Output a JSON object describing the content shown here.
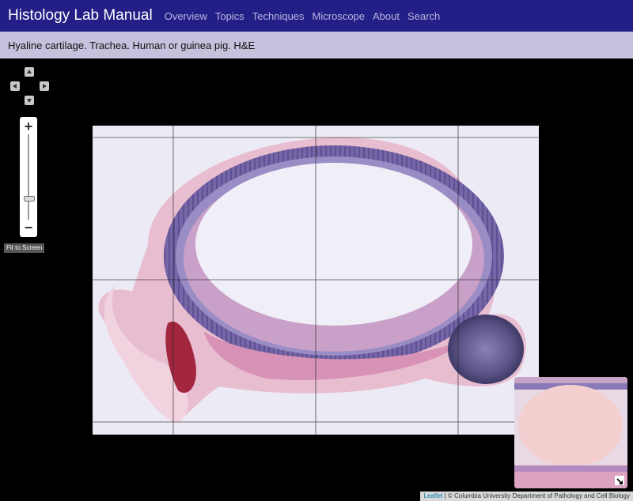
{
  "navbar": {
    "brand": "Histology Lab Manual",
    "links": [
      "Overview",
      "Topics",
      "Techniques",
      "Microscope",
      "About",
      "Search"
    ]
  },
  "subheader": {
    "title": "Hyaline cartilage. Trachea. Human or guinea pig. H&E"
  },
  "viewer": {
    "zoom_in": "+",
    "zoom_out": "−",
    "fit_label": "Fit to Screen",
    "zoom_level": 0.25,
    "attribution": {
      "leaflet": "Leaflet",
      "separator": "|",
      "copyright": "© Columbia University Department of Pathology and Cell Biology"
    }
  },
  "icons": {
    "pan": [
      "arrow-up-icon",
      "arrow-left-icon",
      "arrow-right-icon",
      "arrow-down-icon"
    ],
    "minimap_toggle": "minimize-icon"
  },
  "colors": {
    "navbar_bg": "#231f86",
    "subheader_bg": "#c4c2dc",
    "viewer_bg": "#000000",
    "stain_cartilage": "#6b5a9e",
    "stain_tissue": "#d98fb3"
  }
}
